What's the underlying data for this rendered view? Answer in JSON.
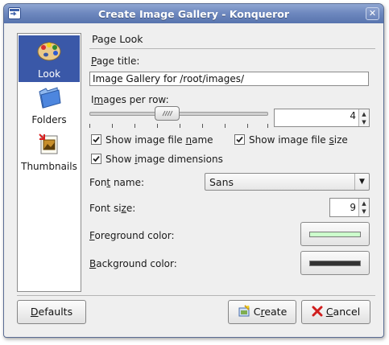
{
  "window": {
    "title": "Create Image Gallery - Konqueror",
    "close_glyph": "✕"
  },
  "sidebar": {
    "items": [
      {
        "label": "Look",
        "icon": "palette-icon",
        "selected": true
      },
      {
        "label": "Folders",
        "icon": "folder-icon",
        "selected": false
      },
      {
        "label": "Thumbnails",
        "icon": "thumbnails-icon",
        "selected": false
      }
    ]
  },
  "page": {
    "heading": "Page Look",
    "page_title_label": {
      "mn": "P",
      "rest": "age title:"
    },
    "page_title_value": "Image Gallery for /root/images/",
    "images_per_row_label": {
      "pre": "I",
      "mn": "m",
      "rest": "ages per row:"
    },
    "images_per_row_value": "4",
    "images_per_row_slider": {
      "min": 1,
      "max": 16,
      "value": 4
    },
    "show_file_name": {
      "pre": "Show image file ",
      "mn": "n",
      "rest": "ame",
      "checked": true
    },
    "show_file_size": {
      "pre": "Show image file ",
      "mn": "s",
      "rest": "ize",
      "checked": true
    },
    "show_dimensions": {
      "pre": "Show ",
      "mn": "i",
      "rest": "mage dimensions",
      "checked": true
    },
    "font_name_label": {
      "pre": "Fon",
      "mn": "t",
      "rest": " name:"
    },
    "font_name_value": "Sans",
    "font_size_label": {
      "pre": "Font si",
      "mn": "z",
      "rest": "e:"
    },
    "font_size_value": "9",
    "fg_label": {
      "mn": "F",
      "rest": "oreground color:"
    },
    "fg_color": "#ccffcc",
    "bg_label": {
      "mn": "B",
      "rest": "ackground color:"
    },
    "bg_color": "#333333"
  },
  "buttons": {
    "defaults": {
      "mn": "D",
      "rest": "efaults"
    },
    "create": {
      "pre": "C",
      "mn": "r",
      "rest": "eate"
    },
    "cancel": {
      "mn": "C",
      "rest": "ancel"
    }
  },
  "colors": {
    "titlebar": "#6f89bf",
    "selection": "#3a58a8"
  }
}
